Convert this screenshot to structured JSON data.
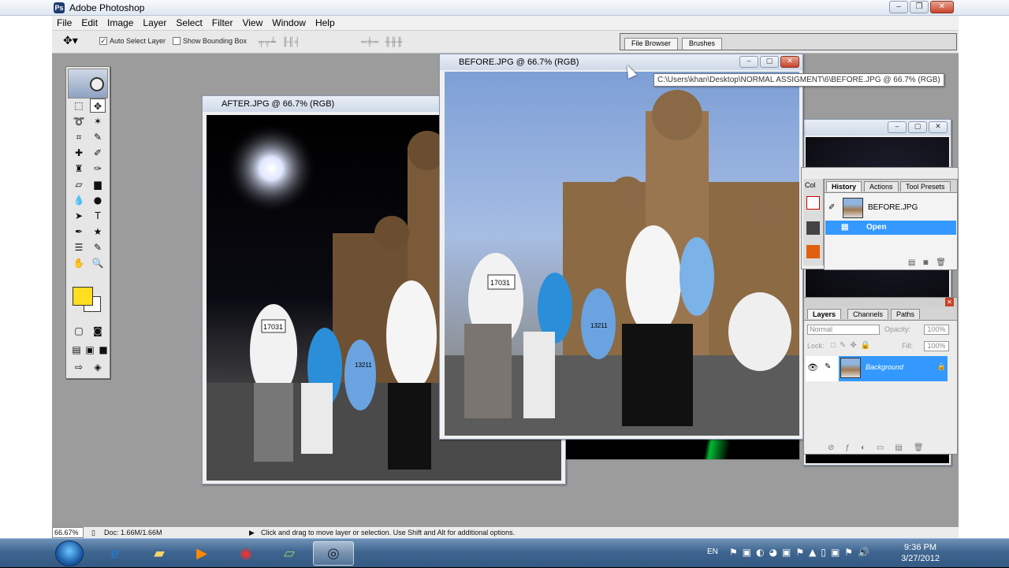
{
  "app": {
    "title": "Adobe Photoshop"
  },
  "menu": [
    "File",
    "Edit",
    "Image",
    "Layer",
    "Select",
    "Filter",
    "View",
    "Window",
    "Help"
  ],
  "options": {
    "auto_select_label": "Auto Select Layer",
    "show_bounding_label": "Show Bounding Box",
    "palette_tabs": [
      "File Browser",
      "Brushes"
    ]
  },
  "docs": {
    "after": {
      "title": "AFTER.JPG @ 66.7% (RGB)"
    },
    "before": {
      "title": "BEFORE.JPG @ 66.7% (RGB)"
    },
    "tooltip": "C:\\Users\\khan\\Desktop\\NORMAL ASSIGMENT\\6\\BEFORE.JPG @ 66.7% (RGB)"
  },
  "photo_labels": {
    "bib_17031": "17031",
    "bib_13211": "13211"
  },
  "history": {
    "tabs": [
      "History",
      "Actions",
      "Tool Presets"
    ],
    "snapshot": "BEFORE.JPG",
    "step": "Open",
    "color_tab": "Col"
  },
  "layers": {
    "tabs": [
      "Layers",
      "Channels",
      "Paths"
    ],
    "blend_mode": "Normal",
    "opacity_label": "Opacity:",
    "opacity": "100%",
    "lock_label": "Lock:",
    "fill_label": "Fill:",
    "fill": "100%",
    "layer_name": "Background"
  },
  "status": {
    "zoom": "66.67%",
    "doc": "Doc: 1.66M/1.66M",
    "hint": "Click and drag to move layer or selection.  Use Shift and Alt for additional options."
  },
  "taskbar": {
    "lang": "EN",
    "time": "9:36 PM",
    "date": "3/27/2012"
  },
  "colors": {
    "foreground": "#ffde21",
    "background": "#ffffff",
    "selection": "#3399ff"
  }
}
